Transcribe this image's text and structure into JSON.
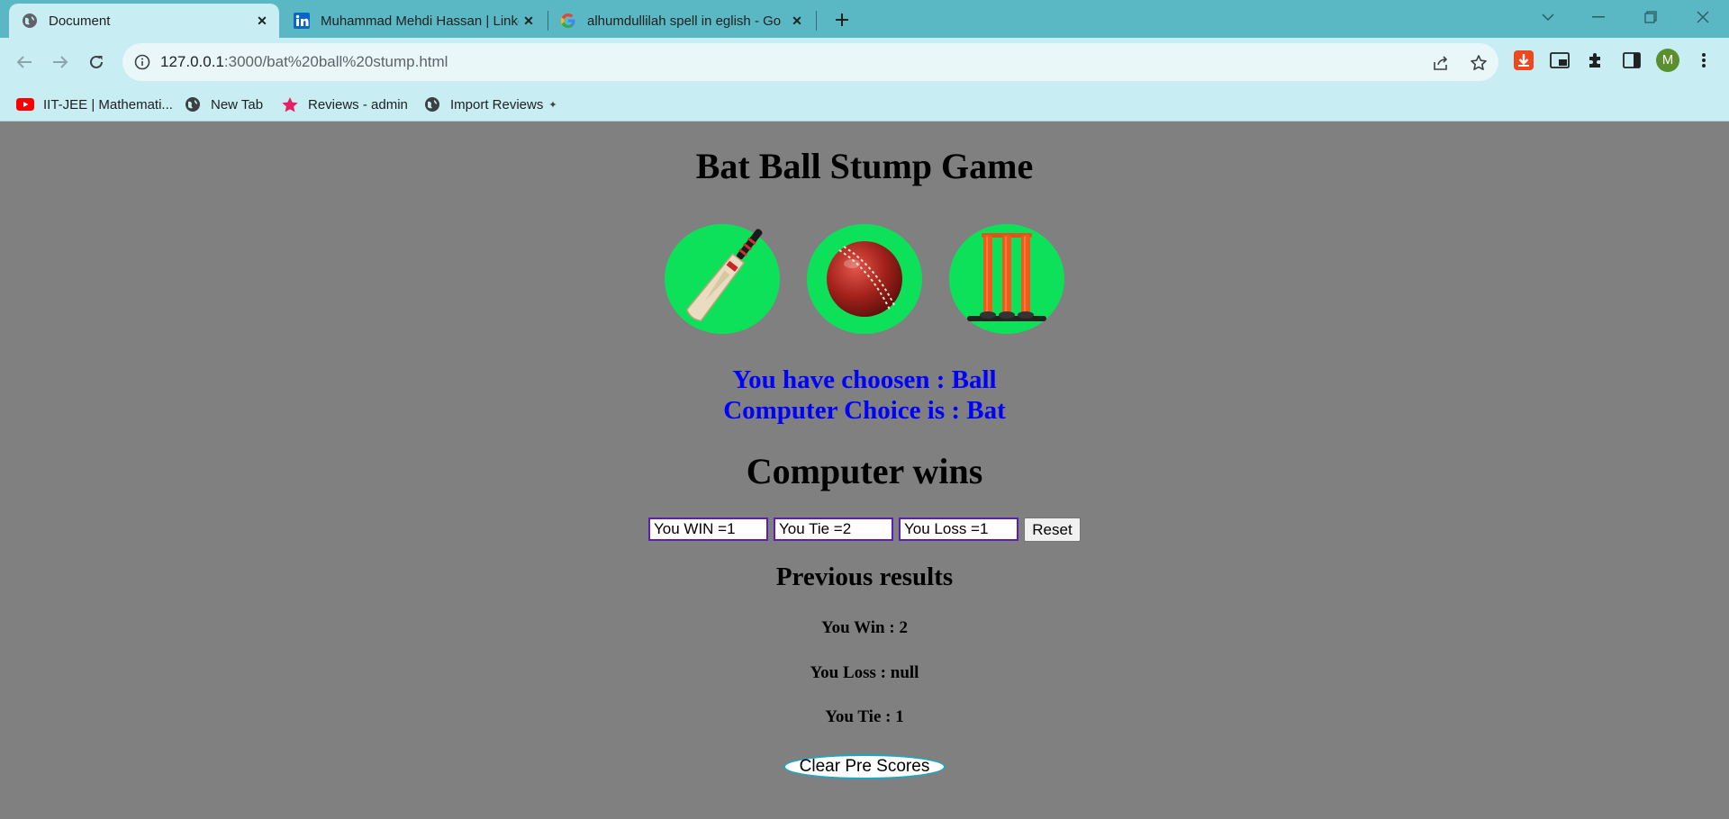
{
  "browser": {
    "tabs": [
      {
        "title": "Document",
        "icon": "globe-icon",
        "active": true
      },
      {
        "title": "Muhammad Mehdi Hassan | Linke",
        "icon": "linkedin-icon",
        "active": false
      },
      {
        "title": "alhumdullilah spell in eglish - Go",
        "icon": "google-icon",
        "active": false
      }
    ],
    "url": {
      "host": "127.0.0.1",
      "rest": ":3000/bat%20ball%20stump.html"
    },
    "profile_initial": "M",
    "bookmarks": [
      {
        "label": "IIT-JEE | Mathemati...",
        "icon": "youtube-icon"
      },
      {
        "label": "New Tab",
        "icon": "globe-icon"
      },
      {
        "label": "Reviews - admin",
        "icon": "star-icon"
      },
      {
        "label": "Import Reviews",
        "icon": "globe-icon"
      }
    ],
    "colors": {
      "tabstrip": "#5ab8c4",
      "toolbar": "#c8eef3"
    }
  },
  "game": {
    "title": "Bat Ball Stump Game",
    "choices": [
      {
        "name": "Bat",
        "icon": "cricket-bat-icon"
      },
      {
        "name": "Ball",
        "icon": "cricket-ball-icon"
      },
      {
        "name": "Stump",
        "icon": "cricket-stumps-icon"
      }
    ],
    "user_choice_text": "You have choosen : Ball",
    "computer_choice_text": "Computer Choice is : Bat",
    "result_text": "Computer wins",
    "scores": {
      "win": "You WIN =1",
      "tie": "You Tie =2",
      "loss": "You Loss =1"
    },
    "reset_label": "Reset",
    "previous": {
      "title": "Previous results",
      "win": "You Win : 2",
      "loss": "You Loss : null",
      "tie": "You Tie : 1"
    },
    "clear_label": "Clear Pre Scores",
    "colors": {
      "background": "#808080",
      "choice_circle": "#0de15a",
      "choice_text": "#0000ff",
      "scorebox_border": "#5b1fb5"
    }
  }
}
